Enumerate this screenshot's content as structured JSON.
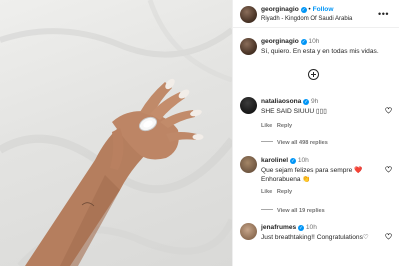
{
  "post": {
    "username": "georginagio",
    "follow_label": "Follow",
    "location": "Riyadh - Kingdom Of Saudi Arabia",
    "caption": "Sí, quiero. En esta y en todas mis vidas.",
    "caption_time": "10h"
  },
  "comments": [
    {
      "username": "nataliaosona",
      "time": "9h",
      "text": "SHE SAID SIUUU ▯▯▯",
      "like_label": "Like",
      "reply_label": "Reply",
      "view_replies": "View all 498 replies"
    },
    {
      "username": "karolinel",
      "time": "10h",
      "text": "Que sejam felizes para sempre ❤️",
      "text2": "Enhorabuena 👏",
      "like_label": "Like",
      "reply_label": "Reply",
      "view_replies": "View all 19 replies"
    },
    {
      "username": "jenafrumes",
      "time": "10h",
      "text": "Just breathtaking!! Congratulations♡"
    }
  ],
  "icons": {
    "more": "more-options-icon",
    "verified": "verified-badge-icon",
    "add_comment": "plus-circle-icon",
    "heart": "heart-icon"
  },
  "colors": {
    "accent": "#0095f6",
    "heart_red": "#e0245e"
  }
}
